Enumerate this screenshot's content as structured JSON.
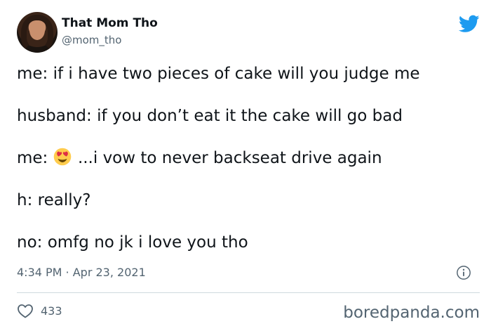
{
  "tweet": {
    "author_name": "That Mom Tho",
    "author_handle": "@mom_tho",
    "lines": [
      {
        "prefix": "",
        "text": "me: if i have two pieces of cake will you judge me"
      },
      {
        "prefix": "",
        "text": "husband: if you don’t eat it the cake will go bad"
      },
      {
        "prefix": "me: ",
        "text": "...i vow to never backseat drive again"
      },
      {
        "prefix": "",
        "text": "h: really?"
      },
      {
        "prefix": "",
        "text": "no: omfg no jk i love you tho"
      }
    ],
    "timestamp": "4:34 PM · Apr 23, 2021",
    "like_count": "433"
  },
  "watermark": "boredpanda.com",
  "icons": {
    "brand": "twitter-bird-icon",
    "info": "info-icon",
    "like": "heart-icon",
    "emoji": "heart-eyes-emoji-icon"
  },
  "colors": {
    "twitter_blue": "#1d9bf0",
    "text": "#0f1419",
    "muted": "#536471",
    "divider": "#cfd9de"
  }
}
